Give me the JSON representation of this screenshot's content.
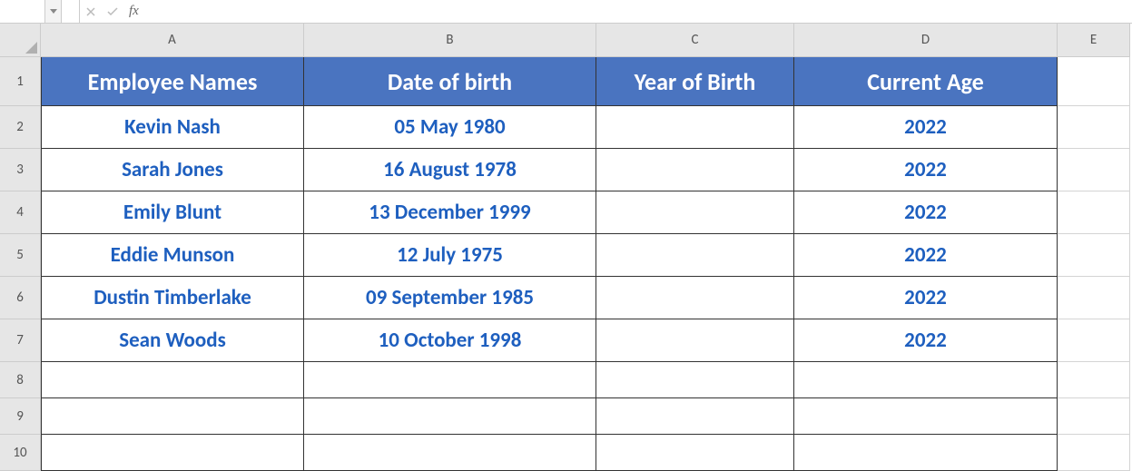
{
  "formula_bar": {
    "name_box": "",
    "formula": ""
  },
  "columns": [
    "A",
    "B",
    "C",
    "D",
    "E"
  ],
  "rows": [
    "1",
    "2",
    "3",
    "4",
    "5",
    "6",
    "7",
    "8",
    "9",
    "10"
  ],
  "headers": {
    "A": "Employee Names",
    "B": "Date of birth",
    "C": "Year of Birth",
    "D": "Current Age"
  },
  "data": [
    {
      "name": "Kevin Nash",
      "dob": "05 May 1980",
      "yob": "",
      "age": "2022"
    },
    {
      "name": "Sarah Jones",
      "dob": "16 August 1978",
      "yob": "",
      "age": "2022"
    },
    {
      "name": "Emily Blunt",
      "dob": "13 December 1999",
      "yob": "",
      "age": "2022"
    },
    {
      "name": "Eddie Munson",
      "dob": "12 July 1975",
      "yob": "",
      "age": "2022"
    },
    {
      "name": "Dustin Timberlake",
      "dob": "09 September 1985",
      "yob": "",
      "age": "2022"
    },
    {
      "name": "Sean Woods",
      "dob": "10 October 1998",
      "yob": "",
      "age": "2022"
    }
  ],
  "chart_data": {
    "type": "table",
    "title": "",
    "columns": [
      "Employee Names",
      "Date of birth",
      "Year of Birth",
      "Current Age"
    ],
    "rows": [
      [
        "Kevin Nash",
        "05 May 1980",
        "",
        "2022"
      ],
      [
        "Sarah Jones",
        "16 August 1978",
        "",
        "2022"
      ],
      [
        "Emily Blunt",
        "13 December 1999",
        "",
        "2022"
      ],
      [
        "Eddie Munson",
        "12 July 1975",
        "",
        "2022"
      ],
      [
        "Dustin Timberlake",
        "09 September 1985",
        "",
        "2022"
      ],
      [
        "Sean Woods",
        "10 October 1998",
        "",
        "2022"
      ]
    ]
  }
}
